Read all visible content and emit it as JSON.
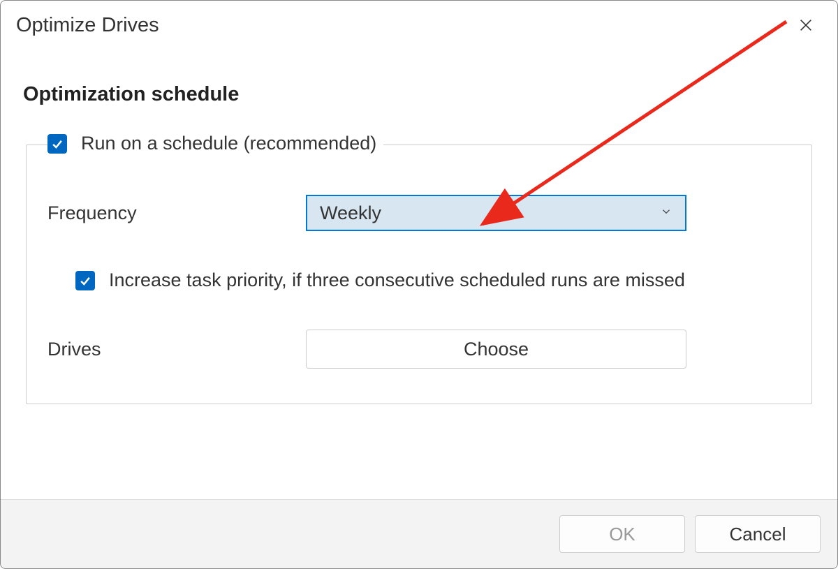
{
  "dialog": {
    "title": "Optimize Drives",
    "section_header": "Optimization schedule",
    "run_schedule": {
      "checked": true,
      "label": "Run on a schedule (recommended)"
    },
    "frequency": {
      "label": "Frequency",
      "value": "Weekly"
    },
    "increase_priority": {
      "checked": true,
      "label": "Increase task priority, if three consecutive scheduled runs are missed"
    },
    "drives": {
      "label": "Drives",
      "button": "Choose"
    },
    "footer": {
      "ok": "OK",
      "cancel": "Cancel"
    }
  }
}
